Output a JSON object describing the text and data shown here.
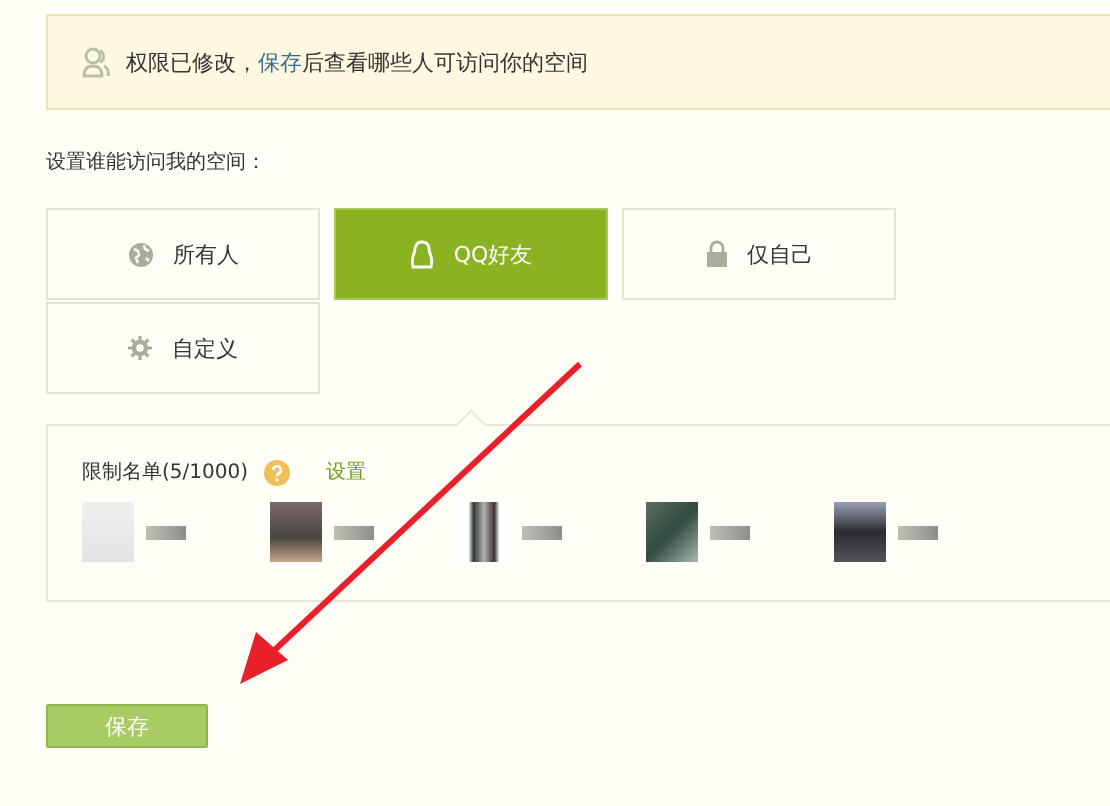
{
  "notice": {
    "before": "权限已修改，",
    "link": "保存",
    "after": "后查看哪些人可访问你的空间"
  },
  "prompt": "设置谁能访问我的空间：",
  "options": [
    {
      "kind": "everyone",
      "label": "所有人",
      "selected": false
    },
    {
      "kind": "friends",
      "label": "QQ好友",
      "selected": true
    },
    {
      "kind": "self",
      "label": "仅自己",
      "selected": false
    },
    {
      "kind": "custom",
      "label": "自定义",
      "selected": false
    }
  ],
  "restricted_list": {
    "title": "限制名单(5/1000)",
    "link": "设置"
  },
  "save_button": "保存"
}
